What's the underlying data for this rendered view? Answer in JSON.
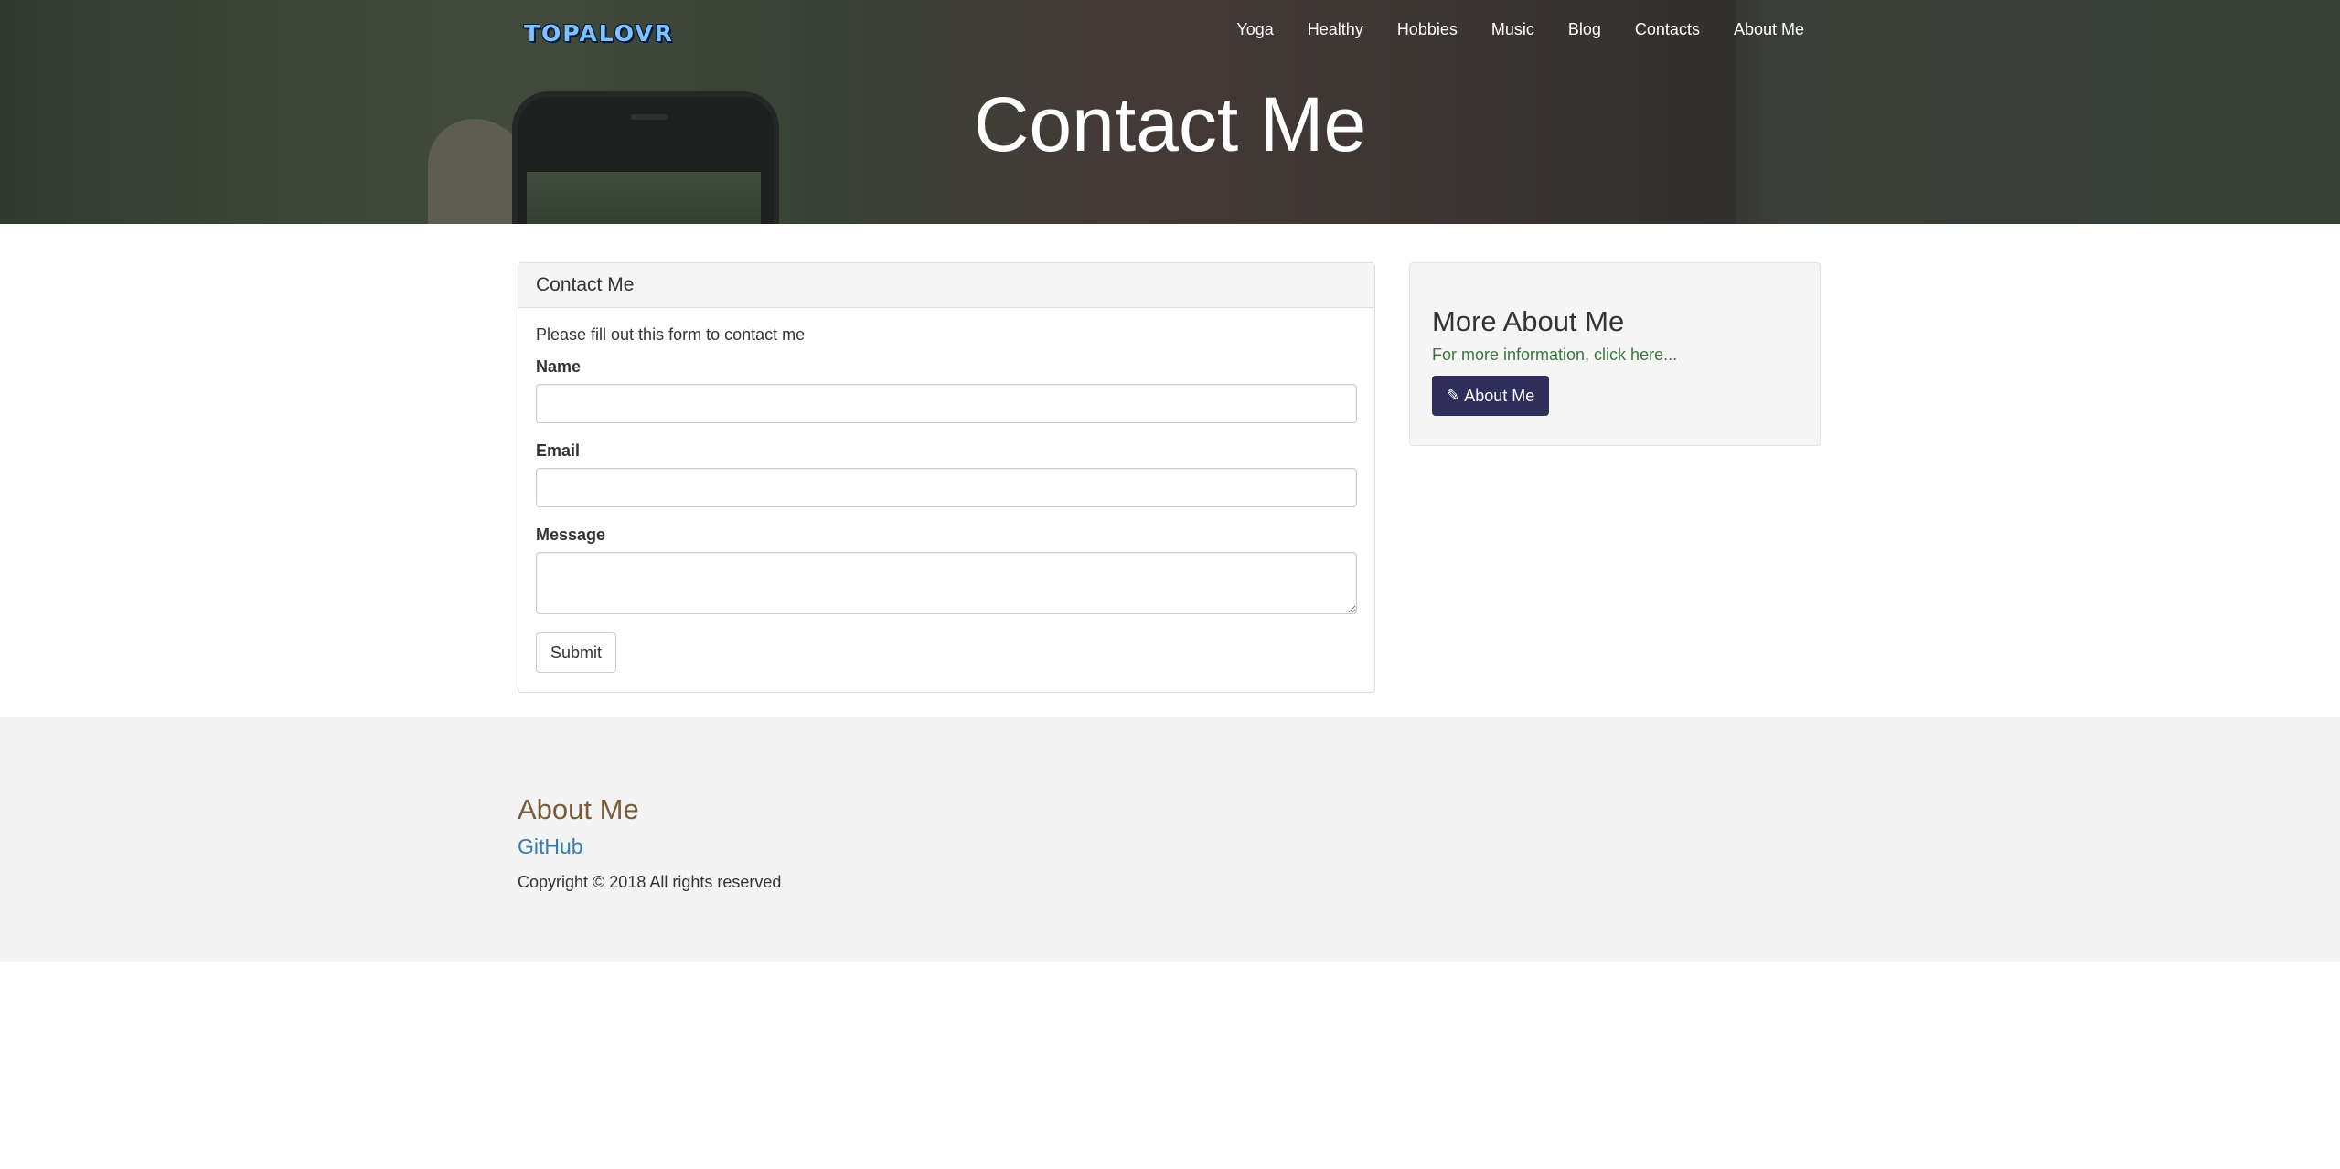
{
  "header": {
    "logo_text": "TOPALOVR",
    "nav": [
      {
        "label": "Yoga"
      },
      {
        "label": "Healthy"
      },
      {
        "label": "Hobbies"
      },
      {
        "label": "Music"
      },
      {
        "label": "Blog"
      },
      {
        "label": "Contacts"
      },
      {
        "label": "About Me"
      }
    ],
    "hero_title": "Contact Me"
  },
  "contact_panel": {
    "heading": "Contact Me",
    "intro": "Please fill out this form to contact me",
    "fields": {
      "name_label": "Name",
      "name_value": "",
      "email_label": "Email",
      "email_value": "",
      "message_label": "Message",
      "message_value": ""
    },
    "submit_label": "Submit"
  },
  "sidebar": {
    "title": "More About Me",
    "text": "For more information, click here...",
    "button_label": "About Me",
    "button_icon": "pencil-icon",
    "button_color": "#2e2f5a",
    "text_color": "#3c763d"
  },
  "footer": {
    "title": "About Me",
    "link_label": "GitHub",
    "copyright": "Copyright © 2018 All rights reserved",
    "title_color": "#7a5c3a",
    "link_color": "#337ab7"
  }
}
